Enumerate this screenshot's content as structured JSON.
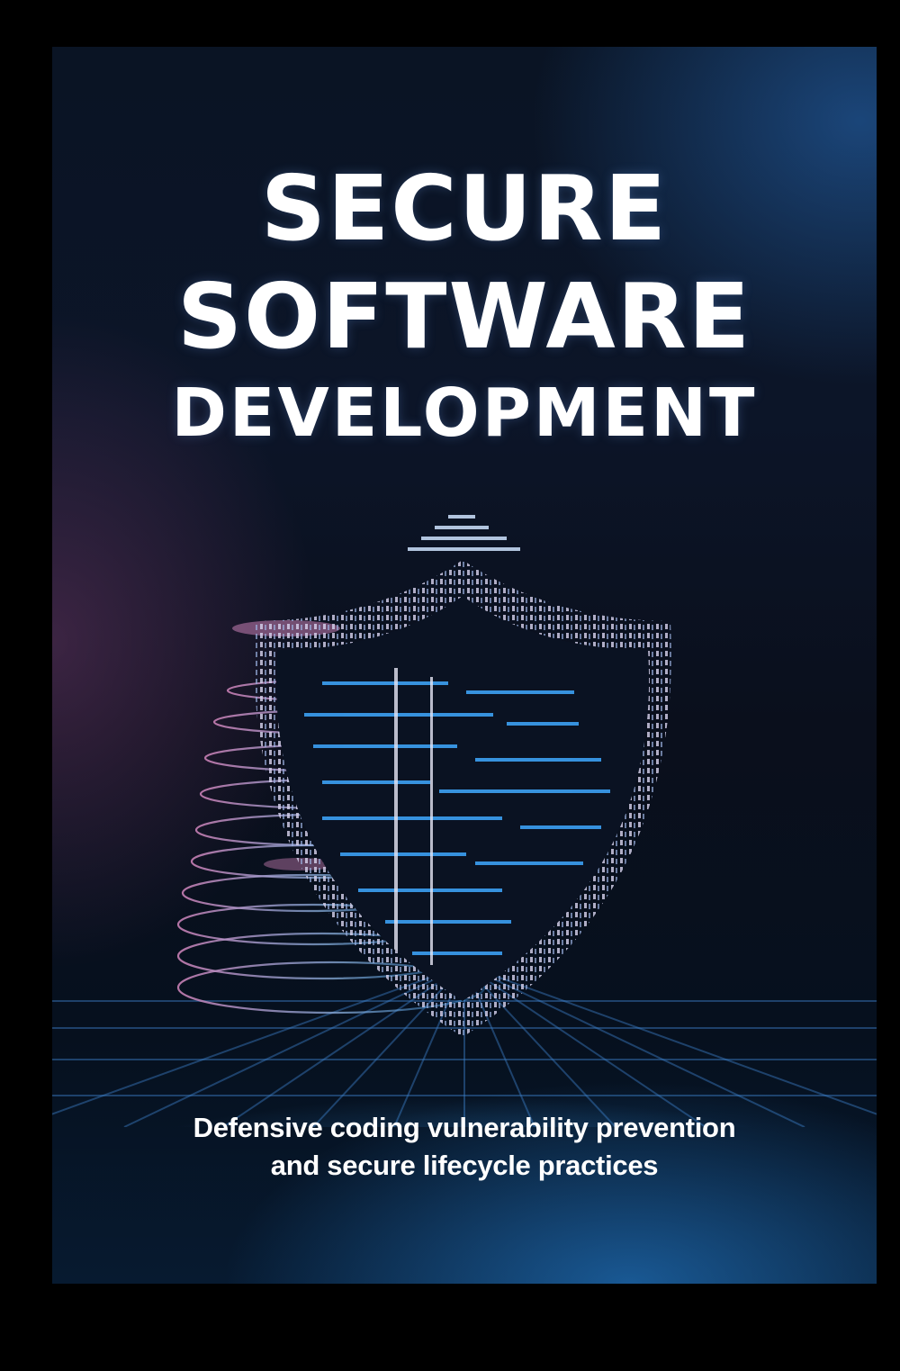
{
  "cover": {
    "title_line1": "SECURE",
    "title_line2": "SOFTWARE",
    "title_line3": "DEVELOPMENT",
    "subtitle_line1": "Defensive coding vulnerability prevention",
    "subtitle_line2": "and secure lifecycle practices"
  },
  "colors": {
    "background": "#0a1424",
    "title": "#ffffff",
    "accent_blue": "#3fa9ff",
    "accent_pink": "#c77fb4"
  },
  "illustration": {
    "icon": "binary-shield-icon"
  }
}
